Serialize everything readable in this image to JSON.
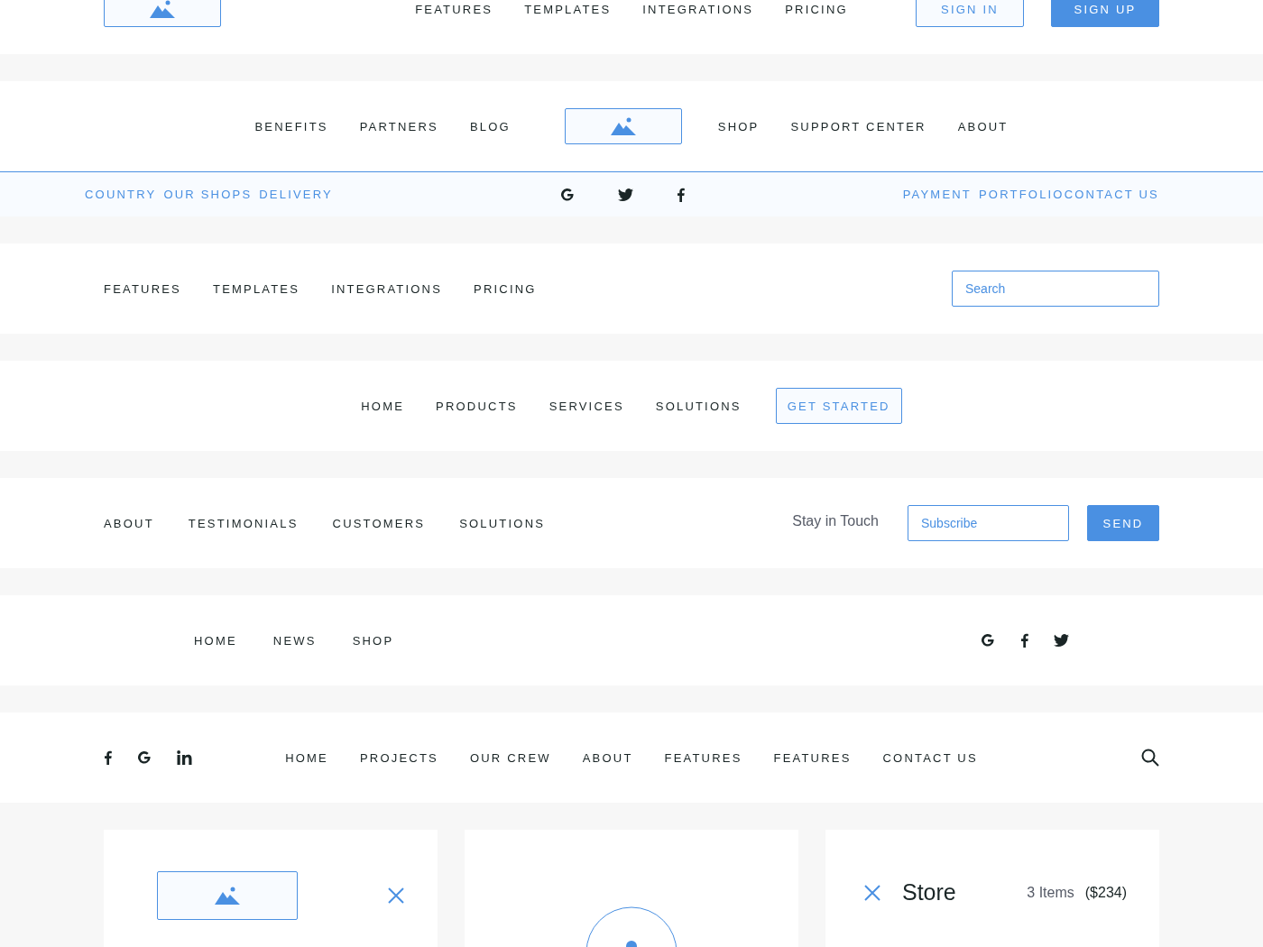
{
  "sections": [
    {
      "kind": "header_auth",
      "links": [
        "FEATURES",
        "TEMPLATES",
        "INTEGRATIONS",
        "PRICING"
      ],
      "buttons": [
        {
          "label": "SIGN IN",
          "kind": "outline"
        },
        {
          "label": "SIGN UP",
          "kind": "filled"
        }
      ]
    },
    {
      "kind": "split_logo",
      "left_links": [
        "BENEFITS",
        "PARTNERS",
        "BLOG"
      ],
      "right_links": [
        "SHOP",
        "SUPPORT CENTER",
        "ABOUT"
      ]
    },
    {
      "kind": "strip",
      "left_links": [
        "COUNTRY",
        "OUR SHOPS",
        "DELIVERY"
      ],
      "socials": [
        {
          "kind": "google"
        },
        {
          "kind": "twitter"
        },
        {
          "kind": "facebook"
        }
      ],
      "right_links": [
        "PAYMENT",
        "PORTFOLIO",
        "CONTACT US"
      ]
    },
    {
      "kind": "links_search",
      "links": [
        "FEATURES",
        "TEMPLATES",
        "INTEGRATIONS",
        "PRICING"
      ],
      "search": {
        "placeholder": "Search"
      }
    },
    {
      "kind": "centered_cta",
      "links": [
        "HOME",
        "PRODUCTS",
        "SERVICES",
        "SOLUTIONS"
      ],
      "button": {
        "label": "GET STARTED"
      }
    },
    {
      "kind": "subscribe",
      "links": [
        "ABOUT",
        "TESTIMONIALS",
        "CUSTOMERS",
        "SOLUTIONS"
      ],
      "prompt": "Stay in Touch",
      "field": {
        "placeholder": "Subscribe"
      },
      "button": {
        "label": "SEND"
      }
    },
    {
      "kind": "links_socials",
      "links": [
        "HOME",
        "NEWS",
        "SHOP"
      ],
      "socials": [
        {
          "kind": "google"
        },
        {
          "kind": "facebook"
        },
        {
          "kind": "twitter"
        }
      ]
    },
    {
      "kind": "socials_links_search",
      "socials": [
        {
          "kind": "facebook"
        },
        {
          "kind": "google"
        },
        {
          "kind": "linkedin"
        }
      ],
      "links": [
        "HOME",
        "PROJECTS",
        "OUR CREW",
        "ABOUT",
        "FEATURES",
        "FEATURES",
        "CONTACT US"
      ]
    }
  ],
  "cards": [
    {
      "kind": "image_close"
    },
    {
      "kind": "avatar"
    },
    {
      "kind": "store",
      "title": "Store",
      "count": "3 Items",
      "total": "($234)"
    }
  ]
}
